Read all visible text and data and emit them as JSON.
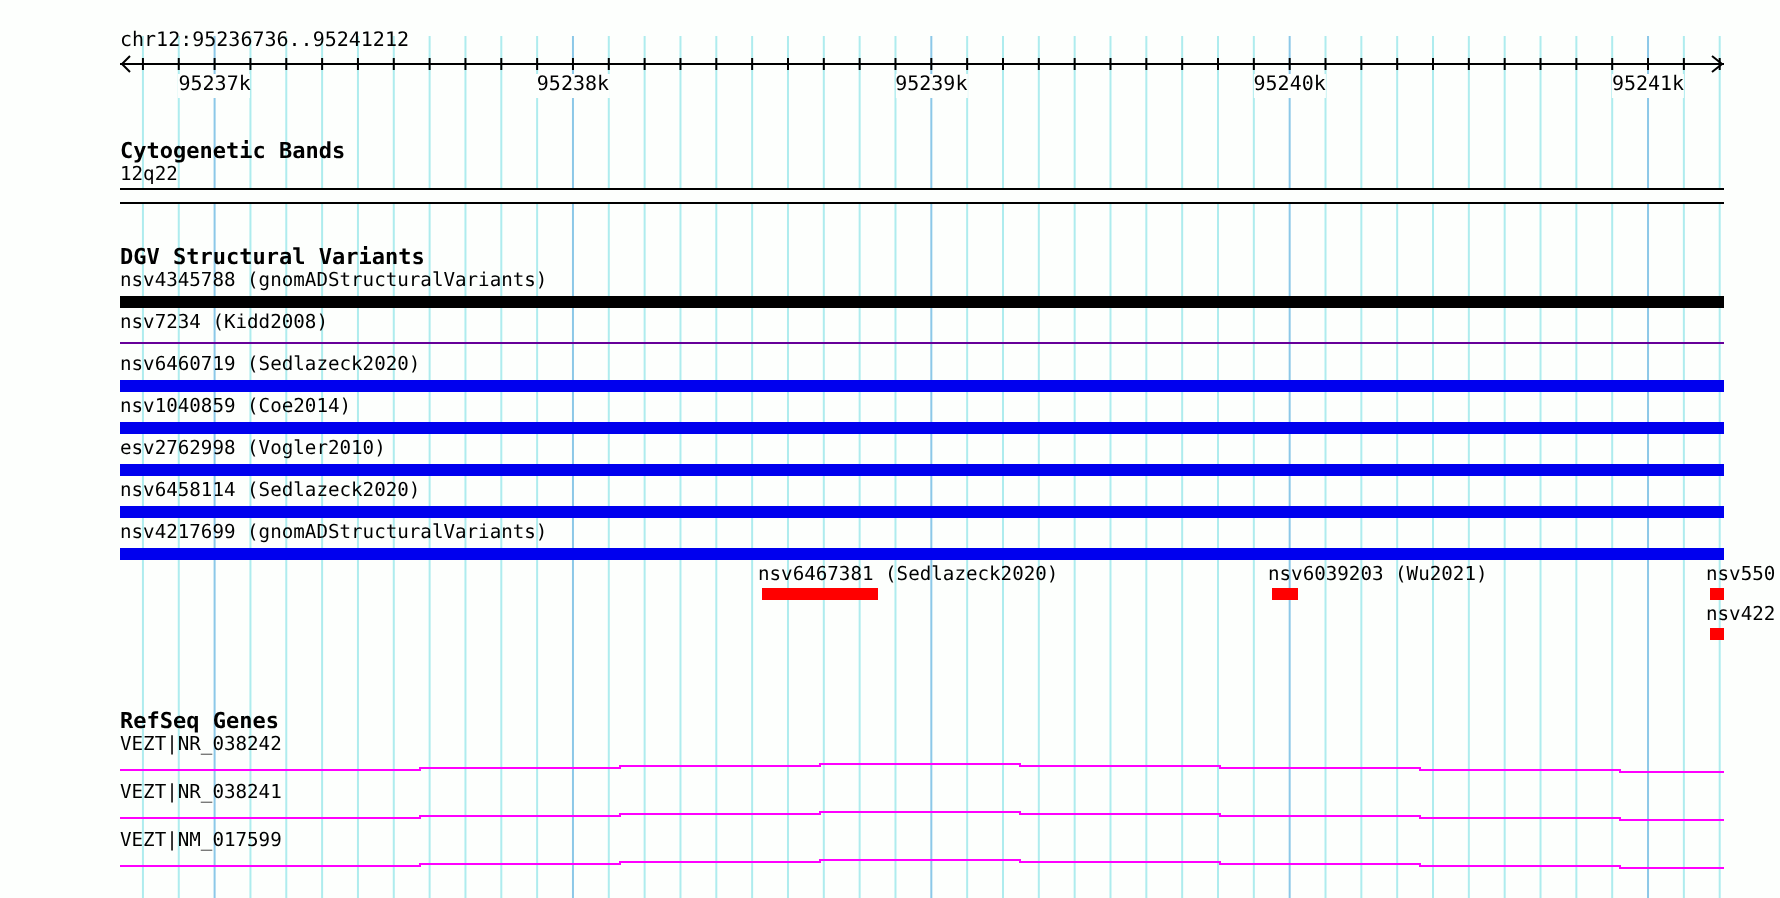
{
  "ruler": {
    "locus": "chr12:95236736..95241212",
    "ticks": [
      "95237k",
      "95238k",
      "95239k",
      "95240k",
      "95241k"
    ]
  },
  "tracks": [
    {
      "kind": "bands",
      "title": "Cytogenetic Bands",
      "features": [
        {
          "label": "12q22"
        }
      ]
    },
    {
      "kind": "variants",
      "title": "DGV Structural Variants",
      "features": [
        {
          "label": "nsv4345788 (gnomADStructuralVariants)",
          "kind": "bar",
          "color": "#000000"
        },
        {
          "label": "nsv7234 (Kidd2008)",
          "kind": "line",
          "color": "#660099"
        },
        {
          "label": "nsv6460719 (Sedlazeck2020)",
          "kind": "bar",
          "color": "#0000ee"
        },
        {
          "label": "nsv1040859 (Coe2014)",
          "kind": "bar",
          "color": "#0000ee"
        },
        {
          "label": "esv2762998 (Vogler2010)",
          "kind": "bar",
          "color": "#0000ee"
        },
        {
          "label": "nsv6458114 (Sedlazeck2020)",
          "kind": "bar",
          "color": "#0000ee"
        },
        {
          "label": "nsv4217699 (gnomADStructuralVariants)",
          "kind": "bar",
          "color": "#0000ee"
        },
        {
          "label": "nsv6467381 (Sedlazeck2020)",
          "kind": "block",
          "color": "#ff0000"
        },
        {
          "label": "nsv6039203 (Wu2021)",
          "kind": "block",
          "color": "#ff0000"
        },
        {
          "label": "nsv550",
          "kind": "block",
          "color": "#ff0000"
        },
        {
          "label": "nsv422",
          "kind": "block",
          "color": "#ff0000"
        }
      ]
    },
    {
      "kind": "genes",
      "title": "RefSeq Genes",
      "features": [
        {
          "label": "VEZT|NR_038242"
        },
        {
          "label": "VEZT|NR_038241"
        },
        {
          "label": "VEZT|NM_017599"
        }
      ]
    }
  ]
}
